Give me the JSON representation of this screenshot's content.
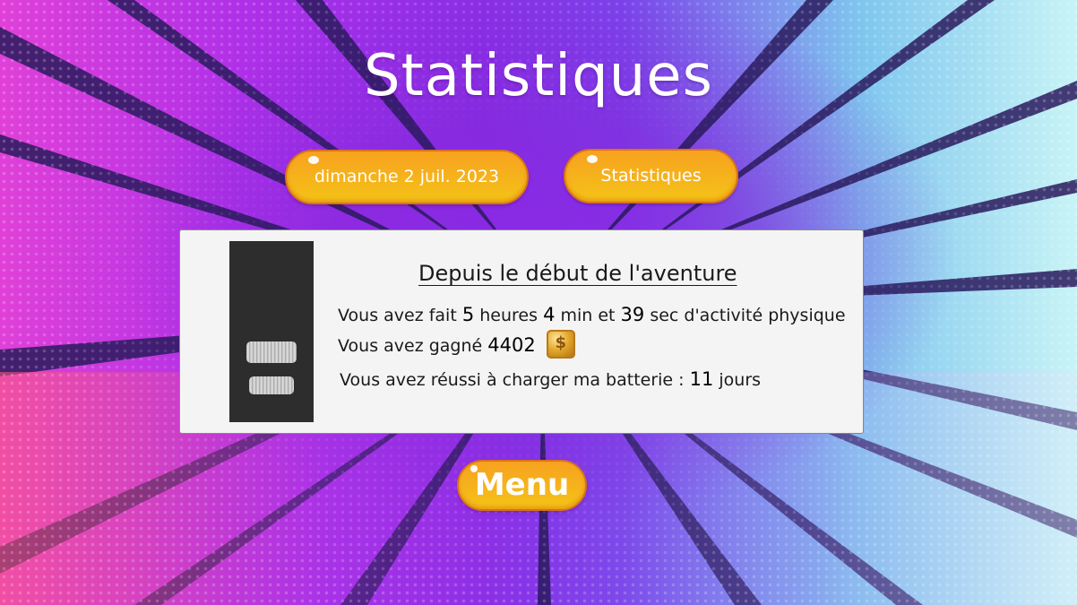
{
  "screen": {
    "title": "Statistiques"
  },
  "buttons": {
    "date_label": "dimanche 2 juil. 2023",
    "stats_label": "Statistiques",
    "menu_label": "Menu"
  },
  "card": {
    "heading": "Depuis le début de l'aventure",
    "activity": {
      "prefix": "Vous avez fait",
      "hours": "5",
      "hours_unit": "heures",
      "minutes": "4",
      "minutes_unit": "min et",
      "seconds": "39",
      "suffix": "sec d'activité physique"
    },
    "earned": {
      "prefix": "Vous avez gagné",
      "amount": "4402",
      "currency_icon": "gold-coin-icon"
    },
    "battery": {
      "prefix": "Vous avez réussi à charger ma batterie :",
      "days": "11",
      "days_unit": "jours"
    }
  },
  "colors": {
    "button_orange": "#f7a21f",
    "button_border": "#d9731a",
    "card_background": "#f4f4f4",
    "panel_dark": "#2d2d2d"
  }
}
